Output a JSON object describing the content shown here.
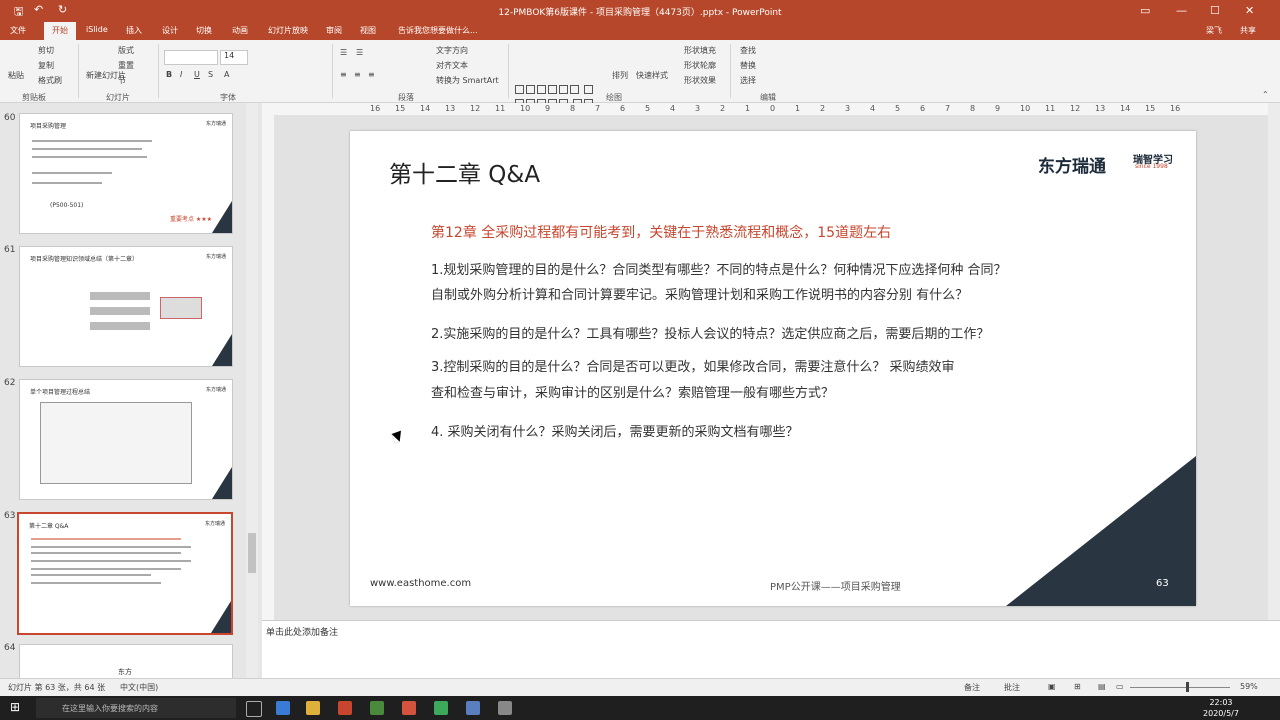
{
  "titlebar": {
    "title": "12-PMBOK第6版课件 - 项目采购管理（4473页）.pptx - PowerPoint",
    "user": "梁飞",
    "share": "共享"
  },
  "tabs": [
    "文件",
    "开始",
    "iSlide",
    "插入",
    "设计",
    "切换",
    "动画",
    "幻灯片放映",
    "审阅",
    "视图"
  ],
  "tell_me": "告诉我您想要做什么...",
  "ribbon": {
    "clipboard": {
      "paste": "粘贴",
      "cut": "剪切",
      "copy": "复制",
      "format_painter": "格式刷",
      "label": "剪贴板"
    },
    "slides": {
      "new": "新建幻灯片",
      "layout": "版式",
      "reset": "重置",
      "section": "节",
      "label": "幻灯片"
    },
    "font_label": "字体",
    "font_size": "14",
    "paragraph": {
      "text_dir": "文字方向",
      "align_text": "对齐文本",
      "smartart": "转换为 SmartArt",
      "label": "段落"
    },
    "drawing": {
      "arrange": "排列",
      "quick_styles": "快速样式",
      "fill": "形状填充",
      "outline": "形状轮廓",
      "effects": "形状效果",
      "label": "绘图"
    },
    "editing": {
      "find": "查找",
      "replace": "替换",
      "select": "选择",
      "label": "编辑"
    }
  },
  "thumbnails": [
    {
      "num": "60",
      "title": "项目采购管理",
      "stamp": "(P500-501)",
      "tag": "重要考点 ★★★"
    },
    {
      "num": "61",
      "title": "项目采购管理知识领域总结（第十二章）",
      "stamp": ""
    },
    {
      "num": "62",
      "title": "单个项目管理过程总结",
      "stamp": ""
    },
    {
      "num": "63",
      "title": "第十二章 Q&A",
      "stamp": ""
    },
    {
      "num": "64",
      "title": "东方",
      "stamp": ""
    }
  ],
  "slide": {
    "title": "第十二章 Q&A",
    "logo": "东方瑞通",
    "logo2": "瑞智学习",
    "logo3": "since 1998",
    "heading": "第12章 全采购过程都有可能考到，关键在于熟悉流程和概念，15道题左右",
    "questions": [
      "1.规划采购管理的目的是什么？合同类型有哪些？不同的特点是什么？何种情况下应选择何种  合同？",
      "   自制或外购分析计算和合同计算要牢记。采购管理计划和采购工作说明书的内容分别 有什么？",
      "2.实施采购的目的是什么？工具有哪些？投标人会议的特点？选定供应商之后，需要后期的工作？",
      "3.控制采购的目的是什么？合同是否可以更改，如果修改合同，需要注意什么？  采购绩效审",
      "   查和检查与审计，采购审计的区别是什么？索赔管理一般有哪些方式？",
      "4. 采购关闭有什么？采购关闭后，需要更新的采购文档有哪些？"
    ],
    "url": "www.easthome.com",
    "footer": "PMP公开课——项目采购管理",
    "page": "63"
  },
  "ruler_numbers": [
    "16",
    "15",
    "14",
    "13",
    "12",
    "11",
    "10",
    "9",
    "8",
    "7",
    "6",
    "5",
    "4",
    "3",
    "2",
    "1",
    "0",
    "1",
    "2",
    "3",
    "4",
    "5",
    "6",
    "7",
    "8",
    "9",
    "10",
    "11",
    "12",
    "13",
    "14",
    "15",
    "16"
  ],
  "notes": {
    "placeholder": "单击此处添加备注"
  },
  "status": {
    "slide_info": "幻灯片 第 63 张，共 64 张",
    "lang": "中文(中国)",
    "notes": "备注",
    "comments": "批注",
    "zoom": "59%"
  },
  "taskbar": {
    "search": "在这里输入你要搜索的内容",
    "time": "22:03",
    "date": "2020/5/7"
  }
}
